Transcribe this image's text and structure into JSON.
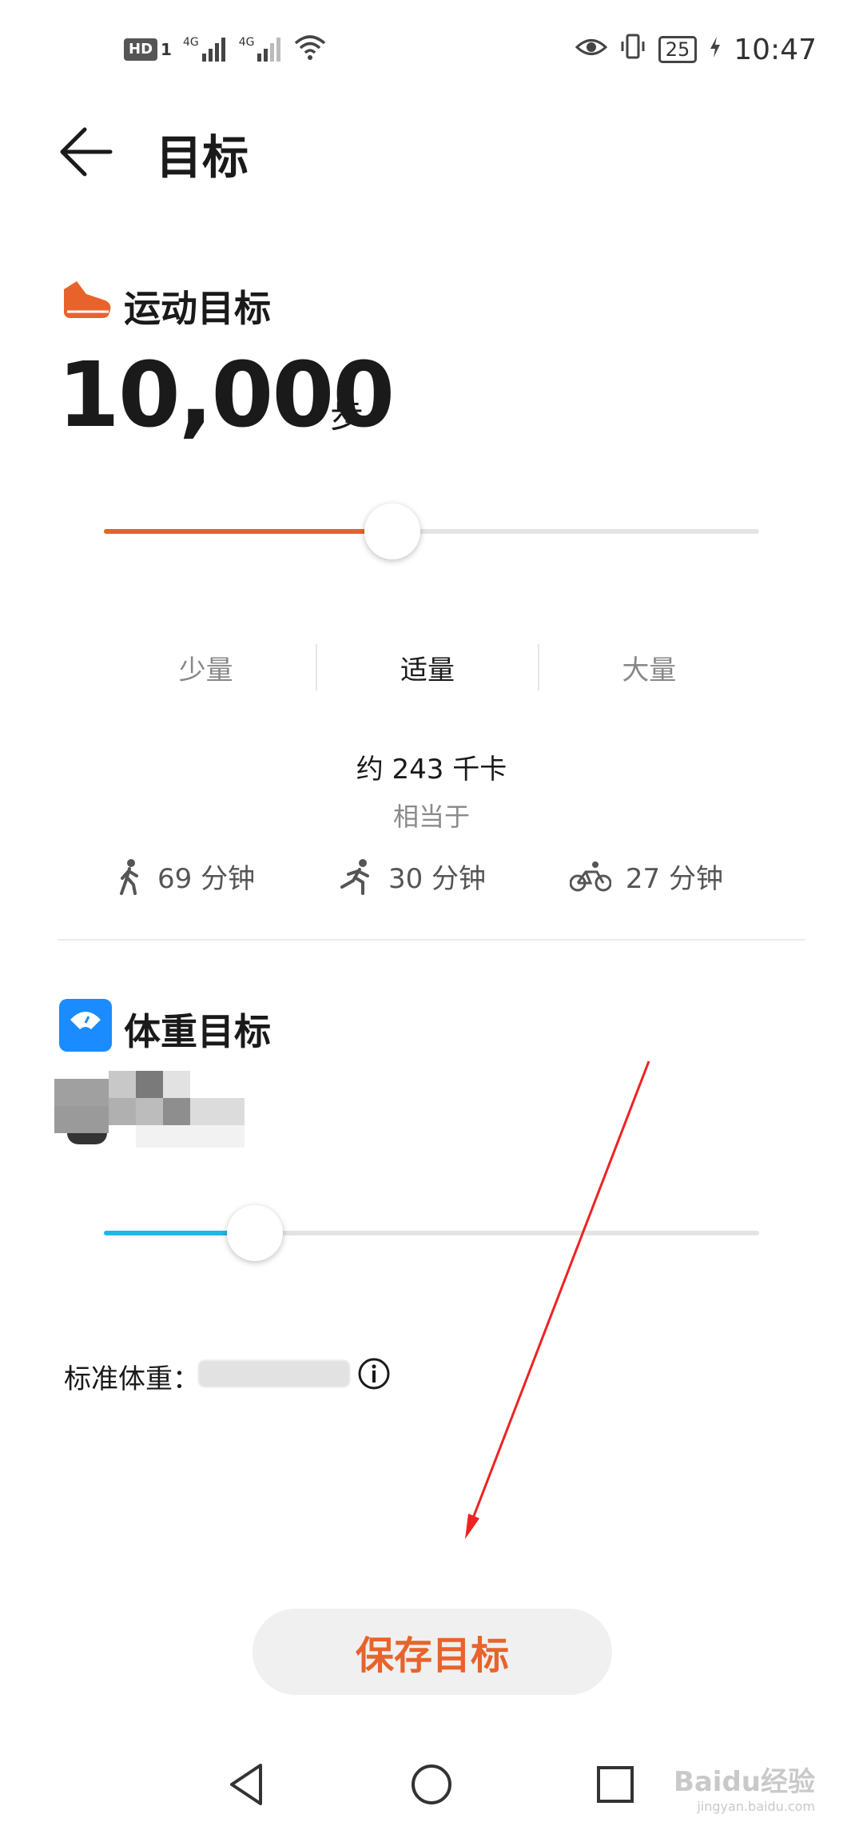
{
  "status_bar": {
    "hd": "HD",
    "sim": "1",
    "net1": "4G",
    "net2": "4G",
    "battery": "25",
    "time": "10:47"
  },
  "header": {
    "title": "目标"
  },
  "exercise": {
    "title": "运动目标",
    "steps": "10,000",
    "unit": "步",
    "slider_fraction": 0.44,
    "levels": [
      "少量",
      "适量",
      "大量"
    ],
    "active_level": 1,
    "calories": "约 243 千卡",
    "equivalent_label": "相当于",
    "activities": [
      {
        "icon": "walk-icon",
        "text": "69 分钟"
      },
      {
        "icon": "run-icon",
        "text": "30 分钟"
      },
      {
        "icon": "bike-icon",
        "text": "27 分钟"
      }
    ]
  },
  "weight": {
    "title": "体重目标",
    "slider_fraction": 0.23,
    "standard_weight_label": "标准体重："
  },
  "save_button": "保存目标",
  "watermark": {
    "main": "Baidu经验",
    "sub": "jingyan.baidu.com"
  },
  "colors": {
    "accent_orange": "#e8632b",
    "weight_blue": "#1a8cff",
    "weight_slider": "#1fb8e8",
    "annotation_red": "#ee2222"
  }
}
